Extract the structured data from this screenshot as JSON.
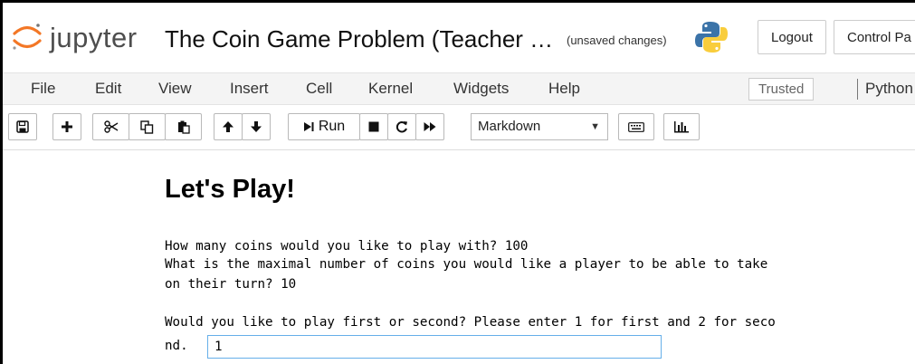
{
  "header": {
    "brand": "jupyter",
    "notebook_title": "The Coin Game Problem (Teacher …",
    "save_status": "(unsaved changes)",
    "logout_label": "Logout",
    "control_panel_label": "Control Pa"
  },
  "menu": {
    "items": [
      "File",
      "Edit",
      "View",
      "Insert",
      "Cell",
      "Kernel",
      "Widgets",
      "Help"
    ],
    "trusted_label": "Trusted",
    "kernel_name": "Python"
  },
  "toolbar": {
    "run_label": "Run",
    "cell_type": "Markdown",
    "icons": [
      "save-icon",
      "plus-icon",
      "cut-icon",
      "copy-icon",
      "paste-icon",
      "arrow-up-icon",
      "arrow-down-icon",
      "step-icon",
      "stop-icon",
      "restart-icon",
      "fast-forward-icon",
      "keyboard-icon",
      "bar-chart-icon"
    ]
  },
  "notebook": {
    "heading": "Let's Play!",
    "output_line1": "How many coins would you like to play with? 100",
    "output_line2": "What is the maximal number of coins you would like a player to be able to take",
    "output_line3": "on their turn? 10",
    "prompt_line1": "Would you like to play first or second? Please enter 1 for first and 2 for seco",
    "prompt_line2": "nd.",
    "input_value": "1"
  },
  "colors": {
    "jupyter_orange": "#f37726",
    "input_focus_border": "#66afe9",
    "menubar_bg": "#f4f4f4"
  }
}
